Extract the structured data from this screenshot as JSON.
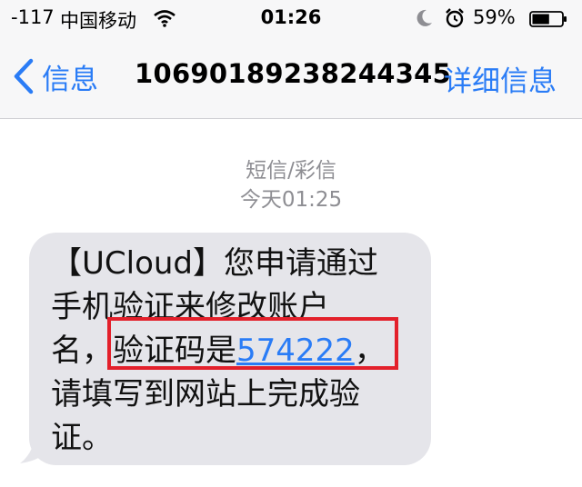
{
  "status_bar": {
    "signal": "-117",
    "carrier": "中国移动",
    "time": "01:26",
    "battery_percent": "59%",
    "battery_level": 0.59
  },
  "nav": {
    "back_label": "信息",
    "title": "10690189238244345",
    "details_label": "详细信息"
  },
  "conversation": {
    "message_type": "短信/彩信",
    "timestamp": "今天01:25",
    "message": {
      "line1": "【UCloud】您申请通过",
      "line2": "手机验证来修改账户",
      "line3_prefix": "名，",
      "line3_text": "验证码是",
      "code": "574222",
      "line3_suffix": "，",
      "line4": "请填写到网站上完成验",
      "line5": "证。"
    }
  },
  "colors": {
    "accent": "#2a7cf6",
    "bubble": "#e5e5ea",
    "highlight_box": "#e3202b",
    "meta_text": "#8e8e93"
  },
  "icons": [
    "wifi-icon",
    "moon-icon",
    "alarm-icon",
    "battery-icon",
    "chevron-left-icon"
  ]
}
